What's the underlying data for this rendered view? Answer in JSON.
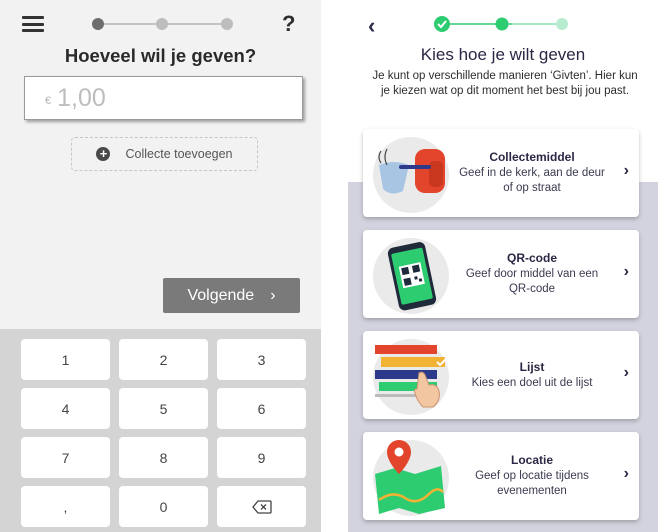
{
  "left_screen": {
    "title": "Hoeveel wil je geven?",
    "help_label": "?",
    "amount": {
      "currency": "€",
      "value": "1,00"
    },
    "add_collect_label": "Collecte toevoegen",
    "next_button": {
      "label": "Volgende",
      "chevron": "›"
    },
    "keypad": [
      "1",
      "2",
      "3",
      "4",
      "5",
      "6",
      "7",
      "8",
      "9",
      ",",
      "0"
    ],
    "icons": {
      "menu": "hamburger-menu-icon",
      "backspace": "backspace-icon",
      "add": "plus-circle-icon"
    },
    "colors": {
      "background": "#f2f2f2",
      "keypad_bg": "#d4d4d4",
      "button": "#7a7a7a"
    }
  },
  "right_screen": {
    "back_chevron": "‹",
    "title": "Kies hoe je wilt geven",
    "description": "Je kunt op verschillende manieren ‘Givten’. Hier kun je kiezen wat op dit moment het best bij jou past.",
    "options": [
      {
        "title": "Collectemiddel",
        "subtitle": "Geef in de kerk, aan de deur of op straat",
        "icon": "collection-bag-icon"
      },
      {
        "title": "QR-code",
        "subtitle": "Geef door middel van een QR-code",
        "icon": "qr-code-phone-icon"
      },
      {
        "title": "Lijst",
        "subtitle": "Kies een doel uit de lijst",
        "icon": "list-select-icon"
      },
      {
        "title": "Locatie",
        "subtitle": "Geef op locatie tijdens evenementen",
        "icon": "map-location-icon"
      }
    ],
    "option_chevron": "›",
    "colors": {
      "accent": "#2ecc71",
      "title": "#2b2744",
      "background": "#d3d3df"
    }
  }
}
